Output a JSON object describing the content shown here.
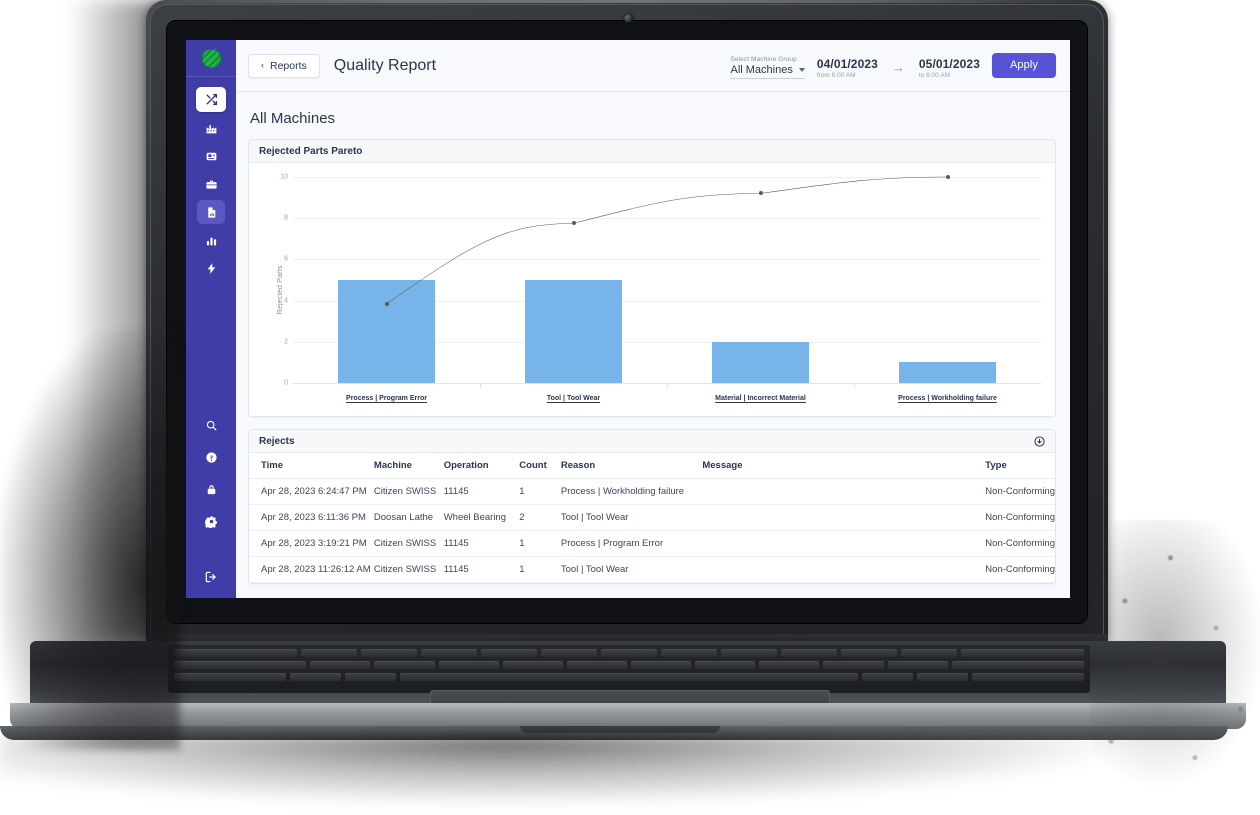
{
  "sidebar": {
    "logo_name": "brand-logo",
    "top_items": [
      {
        "icon": "shuffle-icon",
        "name": "sidebar-item-shuffle",
        "state": "white"
      },
      {
        "icon": "factory-icon",
        "name": "sidebar-item-factory",
        "state": "normal"
      },
      {
        "icon": "machine-icon",
        "name": "sidebar-item-machines",
        "state": "normal"
      },
      {
        "icon": "briefcase-icon",
        "name": "sidebar-item-jobs",
        "state": "normal"
      },
      {
        "icon": "report-document-icon",
        "name": "sidebar-item-reports",
        "state": "active"
      },
      {
        "icon": "bar-chart-icon",
        "name": "sidebar-item-analytics",
        "state": "normal"
      },
      {
        "icon": "lightning-icon",
        "name": "sidebar-item-energy",
        "state": "normal"
      }
    ],
    "bottom_items": [
      {
        "icon": "search-icon",
        "name": "sidebar-item-search"
      },
      {
        "icon": "help-circle-icon",
        "name": "sidebar-item-help"
      },
      {
        "icon": "lock-icon",
        "name": "sidebar-item-security"
      },
      {
        "icon": "gear-icon",
        "name": "sidebar-item-settings"
      },
      {
        "icon": "logout-icon",
        "name": "sidebar-item-logout"
      }
    ]
  },
  "topbar": {
    "back_label": "Reports",
    "back_chevron": "‹",
    "page_title": "Quality Report",
    "machine_group_label": "Select Machine Group",
    "machine_group_value": "All Machines",
    "date_from": "04/01/2023",
    "date_from_sub": "from 6:00 AM",
    "date_arrow": "→",
    "date_to": "05/01/2023",
    "date_to_sub": "to 6:00 AM",
    "apply_label": "Apply"
  },
  "content": {
    "section_title": "All Machines",
    "chart_card_title": "Rejected Parts Pareto",
    "table_card_title": "Rejects",
    "download_icon": "download-circle-icon"
  },
  "chart_data": {
    "type": "bar",
    "title": "Rejected Parts Pareto",
    "xlabel": "",
    "ylabel": "Rejected Parts",
    "ylim": [
      0,
      10
    ],
    "yticks": [
      0,
      2,
      4,
      6,
      8,
      10
    ],
    "grid": true,
    "legend": "none",
    "categories": [
      "Process | Program Error",
      "Tool | Tool Wear",
      "Material | Incorrect Material",
      "Process | Workholding failure"
    ],
    "series": [
      {
        "name": "Rejected Parts",
        "type": "bar",
        "values": [
          5,
          5,
          2,
          1
        ],
        "color": "#77b4ea"
      },
      {
        "name": "Cumulative",
        "type": "line",
        "values": [
          3.85,
          7.75,
          9.2,
          10.0
        ],
        "color": "#5a5a5a"
      }
    ]
  },
  "table": {
    "columns": [
      "Time",
      "Machine",
      "Operation",
      "Count",
      "Reason",
      "Message",
      "Type"
    ],
    "rows": [
      {
        "time": "Apr 28, 2023 6:24:47 PM",
        "machine": "Citizen SWISS",
        "operation": "11145",
        "count": "1",
        "reason": "Process | Workholding failure",
        "message": "",
        "type": "Non-Conforming"
      },
      {
        "time": "Apr 28, 2023 6:11:36 PM",
        "machine": "Doosan Lathe",
        "operation": "Wheel Bearing",
        "count": "2",
        "reason": "Tool | Tool Wear",
        "message": "",
        "type": "Non-Conforming"
      },
      {
        "time": "Apr 28, 2023 3:19:21 PM",
        "machine": "Citizen SWISS",
        "operation": "11145",
        "count": "1",
        "reason": "Process | Program Error",
        "message": "",
        "type": "Non-Conforming"
      },
      {
        "time": "Apr 28, 2023 11:26:12 AM",
        "machine": "Citizen SWISS",
        "operation": "11145",
        "count": "1",
        "reason": "Tool | Tool Wear",
        "message": "",
        "type": "Non-Conforming"
      }
    ]
  },
  "colors": {
    "sidebar": "#413da8",
    "sidebar_active": "#5b57c4",
    "accent": "#5653d6",
    "bar": "#77b4ea",
    "line": "#5a5a5a",
    "text": "#2b3550",
    "page_bg": "#f7f9fc"
  }
}
